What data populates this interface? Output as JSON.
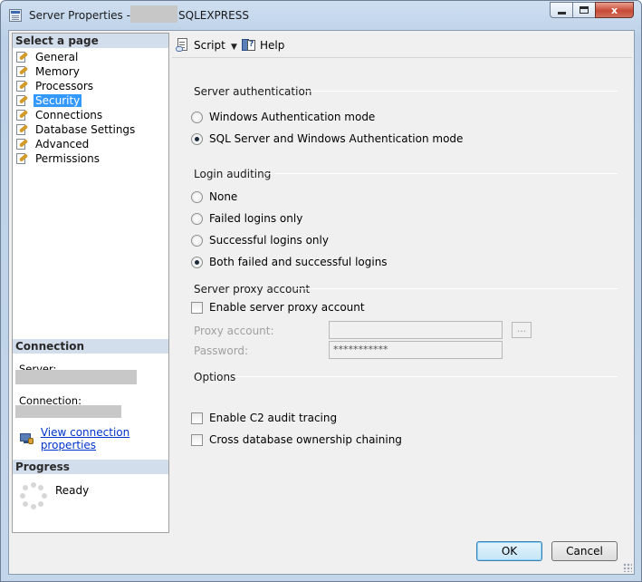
{
  "window": {
    "title_prefix": "Server Properties -",
    "title_suffix": "SQLEXPRESS",
    "minimize_label": "",
    "maximize_label": "",
    "close_label": "x"
  },
  "sidebar": {
    "select_page_header": "Select a page",
    "items": [
      {
        "label": "General"
      },
      {
        "label": "Memory"
      },
      {
        "label": "Processors"
      },
      {
        "label": "Security",
        "selected": true
      },
      {
        "label": "Connections"
      },
      {
        "label": "Database Settings"
      },
      {
        "label": "Advanced"
      },
      {
        "label": "Permissions"
      }
    ],
    "connection_header": "Connection",
    "server_label": "Server:",
    "connection_label": "Connection:",
    "view_connection_link": "View connection properties",
    "progress_header": "Progress",
    "progress_status": "Ready"
  },
  "toolbar": {
    "script_label": "Script",
    "help_label": "Help"
  },
  "security": {
    "server_auth_title": "Server authentication",
    "auth_options": [
      {
        "label": "Windows Authentication mode",
        "checked": false
      },
      {
        "label": "SQL Server and Windows Authentication mode",
        "checked": true
      }
    ],
    "login_auditing_title": "Login auditing",
    "audit_options": [
      {
        "label": "None",
        "checked": false
      },
      {
        "label": "Failed logins only",
        "checked": false
      },
      {
        "label": "Successful logins only",
        "checked": false
      },
      {
        "label": "Both failed and successful logins",
        "checked": true
      }
    ],
    "proxy_title": "Server proxy account",
    "enable_proxy_label": "Enable server proxy account",
    "proxy_account_label": "Proxy account:",
    "proxy_account_value": "",
    "proxy_browse_label": "...",
    "password_label": "Password:",
    "password_value": "***********",
    "options_title": "Options",
    "c2_audit_label": "Enable C2 audit tracing",
    "cross_db_label": "Cross database ownership chaining"
  },
  "footer": {
    "ok_label": "OK",
    "cancel_label": "Cancel"
  }
}
